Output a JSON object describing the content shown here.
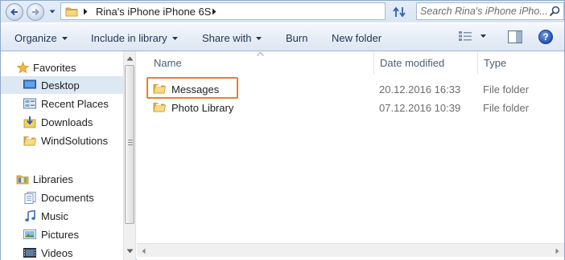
{
  "address_bar": {
    "breadcrumb": "Rina's iPhone iPhone 6S",
    "search_placeholder": "Search Rina's iPhone iPho..."
  },
  "toolbar": {
    "organize": "Organize",
    "include_in_library": "Include in library",
    "share_with": "Share with",
    "burn": "Burn",
    "new_folder": "New folder"
  },
  "navigation": {
    "favorites_header": "Favorites",
    "favorites": [
      {
        "label": "Desktop",
        "icon": "desktop-icon",
        "selected": true
      },
      {
        "label": "Recent Places",
        "icon": "recent-places-icon"
      },
      {
        "label": "Downloads",
        "icon": "downloads-icon"
      },
      {
        "label": "WindSolutions",
        "icon": "folder-icon"
      }
    ],
    "libraries_header": "Libraries",
    "libraries": [
      {
        "label": "Documents",
        "icon": "documents-icon"
      },
      {
        "label": "Music",
        "icon": "music-icon"
      },
      {
        "label": "Pictures",
        "icon": "pictures-icon"
      },
      {
        "label": "Videos",
        "icon": "videos-icon"
      }
    ]
  },
  "file_list": {
    "columns": {
      "name": "Name",
      "date_modified": "Date modified",
      "type": "Type"
    },
    "rows": [
      {
        "name": "Messages",
        "date_modified": "20.12.2016 16:33",
        "type": "File folder",
        "highlighted": true
      },
      {
        "name": "Photo Library",
        "date_modified": "07.12.2016 10:39",
        "type": "File folder"
      }
    ]
  },
  "colors": {
    "highlight_border": "#f07f1e",
    "selection_bg": "#dde8f5",
    "folder_yellow": "#f1c85b"
  }
}
